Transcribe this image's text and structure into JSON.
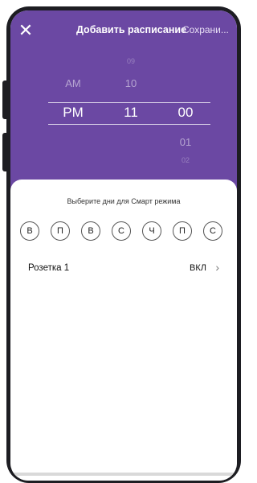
{
  "header": {
    "close_icon": "close-icon",
    "title": "Добавить расписание",
    "save_label": "Сохрани..."
  },
  "picker": {
    "period": {
      "above": "AM",
      "selected": "PM"
    },
    "hours": {
      "above2": "09",
      "above1": "10",
      "selected": "11"
    },
    "minutes": {
      "selected": "00",
      "below1": "01",
      "below2": "02"
    }
  },
  "days": {
    "label": "Выберите дни для Смарт режима",
    "items": [
      "В",
      "П",
      "В",
      "С",
      "Ч",
      "П",
      "С"
    ]
  },
  "outlet": {
    "name": "Розетка 1",
    "state": "ВКЛ",
    "chevron_icon": "chevron-right-icon"
  },
  "colors": {
    "accent": "#6b48a3",
    "frame": "#1d1d22"
  }
}
